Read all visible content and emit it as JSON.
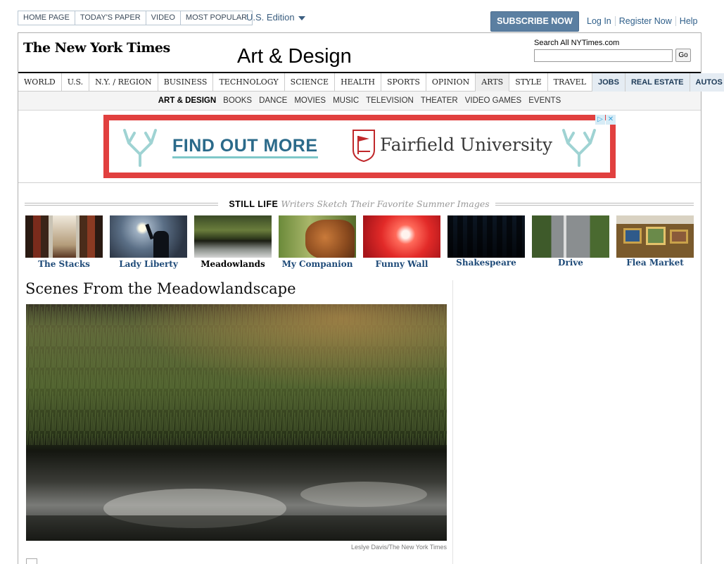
{
  "topnav": [
    "HOME PAGE",
    "TODAY'S PAPER",
    "VIDEO",
    "MOST POPULAR"
  ],
  "edition": "U.S. Edition",
  "account": {
    "subscribe": "SUBSCRIBE NOW",
    "login": "Log In",
    "register": "Register Now",
    "help": "Help"
  },
  "masthead": {
    "logo": "The New York Times",
    "section": "Art & Design"
  },
  "search": {
    "label": "Search All NYTimes.com",
    "go": "Go",
    "value": ""
  },
  "sections": [
    {
      "label": "WORLD"
    },
    {
      "label": "U.S."
    },
    {
      "label": "N.Y. / REGION"
    },
    {
      "label": "BUSINESS"
    },
    {
      "label": "TECHNOLOGY"
    },
    {
      "label": "SCIENCE"
    },
    {
      "label": "HEALTH"
    },
    {
      "label": "SPORTS"
    },
    {
      "label": "OPINION"
    },
    {
      "label": "ARTS"
    },
    {
      "label": "STYLE"
    },
    {
      "label": "TRAVEL"
    },
    {
      "label": "JOBS"
    },
    {
      "label": "REAL ESTATE"
    },
    {
      "label": "AUTOS"
    }
  ],
  "subsections": [
    "ART & DESIGN",
    "BOOKS",
    "DANCE",
    "MOVIES",
    "MUSIC",
    "TELEVISION",
    "THEATER",
    "VIDEO GAMES",
    "EVENTS"
  ],
  "ad": {
    "cta": "FIND OUT MORE",
    "advertiser": "Fairfield University",
    "close": "✕",
    "info": "▷"
  },
  "still_life": {
    "kicker": "STILL LIFE",
    "tagline": "Writers Sketch Their Favorite Summer Images",
    "items": [
      "The Stacks",
      "Lady Liberty",
      "Meadowlands",
      "My Companion",
      "Funny Wall",
      "Shakespeare",
      "Drive",
      "Flea Market"
    ]
  },
  "article": {
    "title": "Scenes From the Meadowlandscape",
    "credit": "Leslye Davis/The New York Times"
  }
}
